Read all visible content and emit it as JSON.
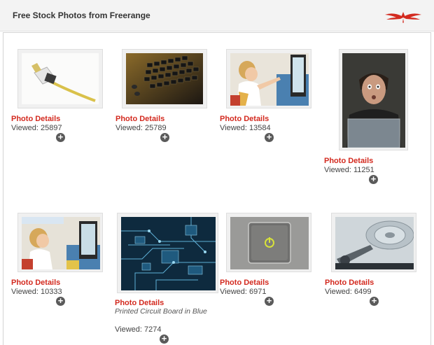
{
  "header": {
    "title": "Free Stock Photos from Freerange",
    "logo_icon": "winged-logo-icon",
    "accent": "#d32a1f"
  },
  "photos": [
    {
      "details_label": "Photo Details",
      "viewed": "Viewed: 25897",
      "subject": "network-cable"
    },
    {
      "details_label": "Photo Details",
      "viewed": "Viewed: 25789",
      "subject": "keyboard"
    },
    {
      "details_label": "Photo Details",
      "viewed": "Viewed: 13584",
      "subject": "girl-computer"
    },
    {
      "details_label": "Photo Details",
      "viewed": "Viewed: 11251",
      "subject": "man-laptop"
    },
    {
      "details_label": "Photo Details",
      "viewed": "Viewed: 10333",
      "subject": "girl-computer-2"
    },
    {
      "details_label": "Photo Details",
      "caption": "Printed Circuit Board in Blue",
      "viewed": "Viewed: 7274",
      "subject": "circuit-board"
    },
    {
      "details_label": "Photo Details",
      "viewed": "Viewed: 6971",
      "subject": "power-button"
    },
    {
      "details_label": "Photo Details",
      "viewed": "Viewed: 6499",
      "subject": "hard-drive"
    }
  ],
  "add_icon": "plus-circle-icon"
}
